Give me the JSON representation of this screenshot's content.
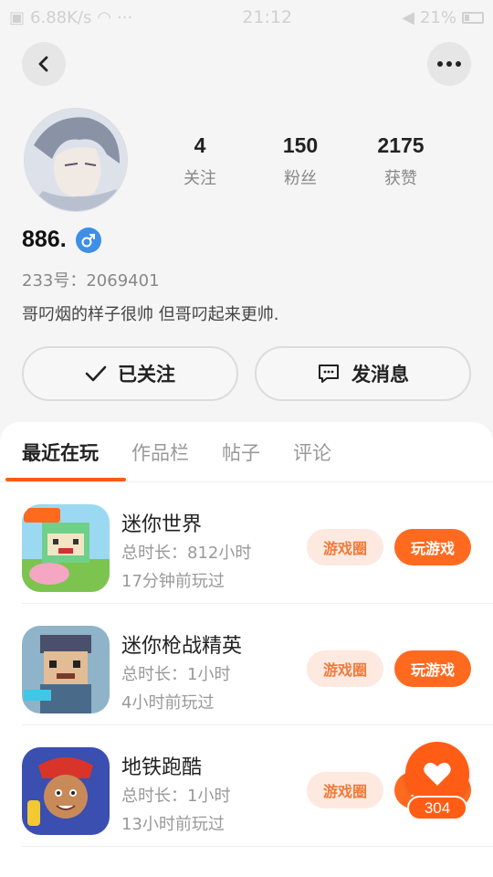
{
  "status_bar": {
    "net_speed": "6.88K/s",
    "time": "21:12",
    "battery": "21%"
  },
  "nav": {
    "back_icon": "chevron-left-icon",
    "more_icon": "more-horizontal-icon"
  },
  "profile": {
    "stats": [
      {
        "value": "4",
        "label": "关注"
      },
      {
        "value": "150",
        "label": "粉丝"
      },
      {
        "value": "2175",
        "label": "获赞"
      }
    ],
    "username": "886.",
    "gender_icon": "male-icon",
    "id_text": "233号：2069401",
    "bio": "哥叼烟的样子很帅 但哥叼起来更帅."
  },
  "actions": {
    "follow_label": "已关注",
    "message_label": "发消息"
  },
  "tabs": [
    {
      "label": "最近在玩",
      "active": true
    },
    {
      "label": "作品栏",
      "active": false
    },
    {
      "label": "帖子",
      "active": false
    },
    {
      "label": "评论",
      "active": false
    }
  ],
  "games": [
    {
      "name": "迷你世界",
      "duration": "总时长：812小时",
      "last_played": "17分钟前玩过",
      "circle_label": "游戏圈",
      "play_label": "玩游戏"
    },
    {
      "name": "迷你枪战精英",
      "duration": "总时长：1小时",
      "last_played": "4小时前玩过",
      "circle_label": "游戏圈",
      "play_label": "玩游戏"
    },
    {
      "name": "地铁跑酷",
      "duration": "总时长：1小时",
      "last_played": "13小时前玩过",
      "circle_label": "游戏圈",
      "play_label": "玩游戏"
    }
  ],
  "fab": {
    "icon": "heart-icon",
    "count": "304"
  },
  "colors": {
    "accent": "#ff5c16",
    "accent_light": "#fde9df",
    "male_badge": "#3d8fe8"
  }
}
